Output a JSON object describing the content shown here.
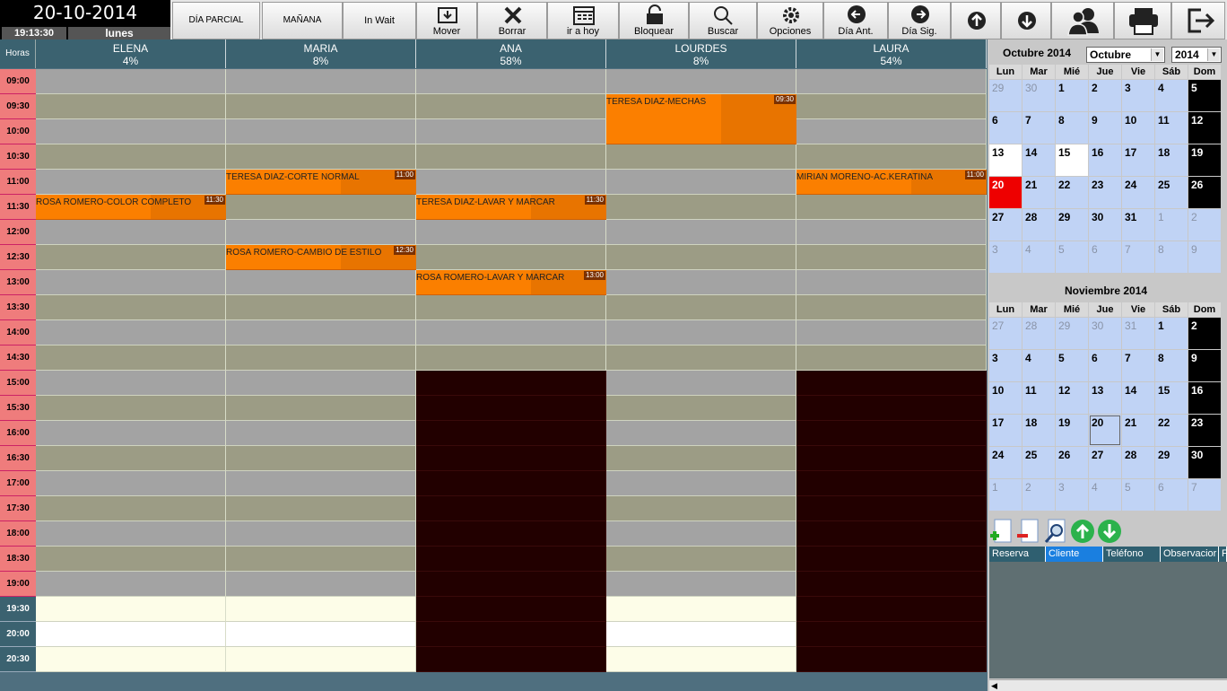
{
  "header": {
    "date": "20-10-2014",
    "time": "19:13:30",
    "weekday": "lunes"
  },
  "toolbar": {
    "text_buttons": [
      "DÍA PARCIAL",
      "MAÑANA",
      "In Wait Manager"
    ],
    "buttons": [
      {
        "label": "Mover",
        "icon": "move-icon"
      },
      {
        "label": "Borrar",
        "icon": "delete-icon"
      },
      {
        "label": "ir a hoy",
        "icon": "calendar-today-icon"
      },
      {
        "label": "Bloquear",
        "icon": "lock-icon"
      },
      {
        "label": "Buscar",
        "icon": "search-icon"
      },
      {
        "label": "Opciones",
        "icon": "gear-icon"
      },
      {
        "label": "Día Ant.",
        "icon": "arrow-left-icon"
      },
      {
        "label": "Día Sig.",
        "icon": "arrow-right-icon"
      }
    ],
    "icon_buttons": [
      "arrow-up-icon",
      "arrow-down-icon",
      "users-icon",
      "printer-icon",
      "exit-icon"
    ]
  },
  "schedule": {
    "horas_label": "Horas",
    "staff": [
      {
        "name": "ELENA",
        "pct": "4%"
      },
      {
        "name": "MARIA",
        "pct": "8%"
      },
      {
        "name": "ANA",
        "pct": "58%"
      },
      {
        "name": "LOURDES",
        "pct": "8%"
      },
      {
        "name": "LAURA",
        "pct": "54%"
      }
    ],
    "times": [
      "09:00",
      "09:30",
      "10:00",
      "10:30",
      "11:00",
      "11:30",
      "12:00",
      "12:30",
      "13:00",
      "13:30",
      "14:00",
      "14:30",
      "15:00",
      "15:30",
      "16:00",
      "16:30",
      "17:00",
      "17:30",
      "18:00",
      "18:30",
      "19:00",
      "19:30",
      "20:00",
      "20:30"
    ],
    "appointments": [
      {
        "staff": 3,
        "start": 1,
        "slots": 2,
        "text": "TERESA DIAZ-MECHAS",
        "time": "09:30"
      },
      {
        "staff": 1,
        "start": 4,
        "slots": 1,
        "text": "TERESA DIAZ-CORTE NORMAL",
        "time": "11:00"
      },
      {
        "staff": 4,
        "start": 4,
        "slots": 1,
        "text": "MIRIAN MORENO-AC.KERATINA",
        "time": "11:00"
      },
      {
        "staff": 0,
        "start": 5,
        "slots": 1,
        "text": "ROSA ROMERO-COLOR COMPLETO",
        "time": "11:30"
      },
      {
        "staff": 2,
        "start": 5,
        "slots": 1,
        "text": "TERESA DIAZ-LAVAR Y MARCAR",
        "time": "11:30"
      },
      {
        "staff": 1,
        "start": 7,
        "slots": 1,
        "text": "ROSA ROMERO-CAMBIO DE ESTILO",
        "time": "12:30"
      },
      {
        "staff": 2,
        "start": 8,
        "slots": 1,
        "text": "ROSA ROMERO-LAVAR Y MARCAR",
        "time": "13:00"
      }
    ],
    "colors": {
      "appt": "#fb7f00",
      "blocked": "#220000",
      "gray": "#a3a3a3",
      "olive": "#9c9c85",
      "cream": "#fdfde8"
    }
  },
  "calendar": {
    "month_select": "Octubre",
    "year_select": "2014",
    "weekdays": [
      "Lun",
      "Mar",
      "Mié",
      "Jue",
      "Vie",
      "Sáb",
      "Dom"
    ],
    "months": [
      {
        "title": "Octubre 2014",
        "days": [
          "29",
          "30",
          "1",
          "2",
          "3",
          "4",
          "5",
          "6",
          "7",
          "8",
          "9",
          "10",
          "11",
          "12",
          "13",
          "14",
          "15",
          "16",
          "17",
          "18",
          "19",
          "20",
          "21",
          "22",
          "23",
          "24",
          "25",
          "26",
          "27",
          "28",
          "29",
          "30",
          "31",
          "1",
          "2",
          "3",
          "4",
          "5",
          "6",
          "7",
          "8",
          "9"
        ],
        "first": 2,
        "last": 32
      },
      {
        "title": "Noviembre 2014",
        "days": [
          "27",
          "28",
          "29",
          "30",
          "31",
          "1",
          "2",
          "3",
          "4",
          "5",
          "6",
          "7",
          "8",
          "9",
          "10",
          "11",
          "12",
          "13",
          "14",
          "15",
          "16",
          "17",
          "18",
          "19",
          "20",
          "21",
          "22",
          "23",
          "24",
          "25",
          "26",
          "27",
          "28",
          "29",
          "30",
          "1",
          "2",
          "3",
          "4",
          "5",
          "6",
          "7"
        ],
        "first": 5,
        "last": 34
      }
    ]
  },
  "list": {
    "columns": [
      "Reserva",
      "Cliente",
      "Teléfono",
      "Observacior",
      "F"
    ]
  }
}
